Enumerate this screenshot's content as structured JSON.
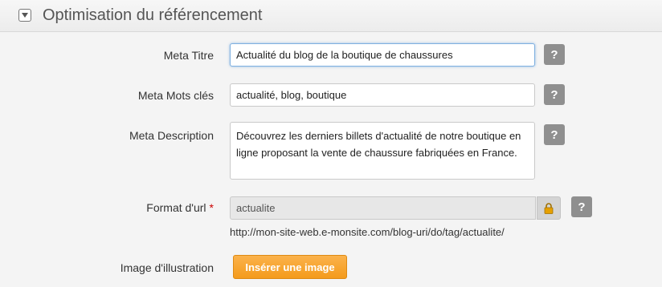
{
  "panel": {
    "title": "Optimisation du référencement",
    "toggle_icon": "chevron-down-icon"
  },
  "fields": {
    "meta_title": {
      "label": "Meta Titre",
      "value": "Actualité du blog de la boutique de chaussures"
    },
    "meta_keywords": {
      "label": "Meta Mots clés",
      "value": "actualité, blog, boutique"
    },
    "meta_description": {
      "label": "Meta Description",
      "value": "Découvrez les derniers billets d'actualité de notre boutique en ligne proposant la vente de chaussure fabriquées en France."
    },
    "url_format": {
      "label": "Format d'url",
      "required_mark": "*",
      "value": "actualite",
      "preview": "http://mon-site-web.e-monsite.com/blog-uri/do/tag/actualite/"
    },
    "image": {
      "label": "Image d'illustration",
      "button_label": "Insérer une image"
    }
  },
  "help_label": "?",
  "colors": {
    "accent_button": "#f49b1c",
    "help_button": "#8f8f8f",
    "lock": "#e6a000"
  }
}
